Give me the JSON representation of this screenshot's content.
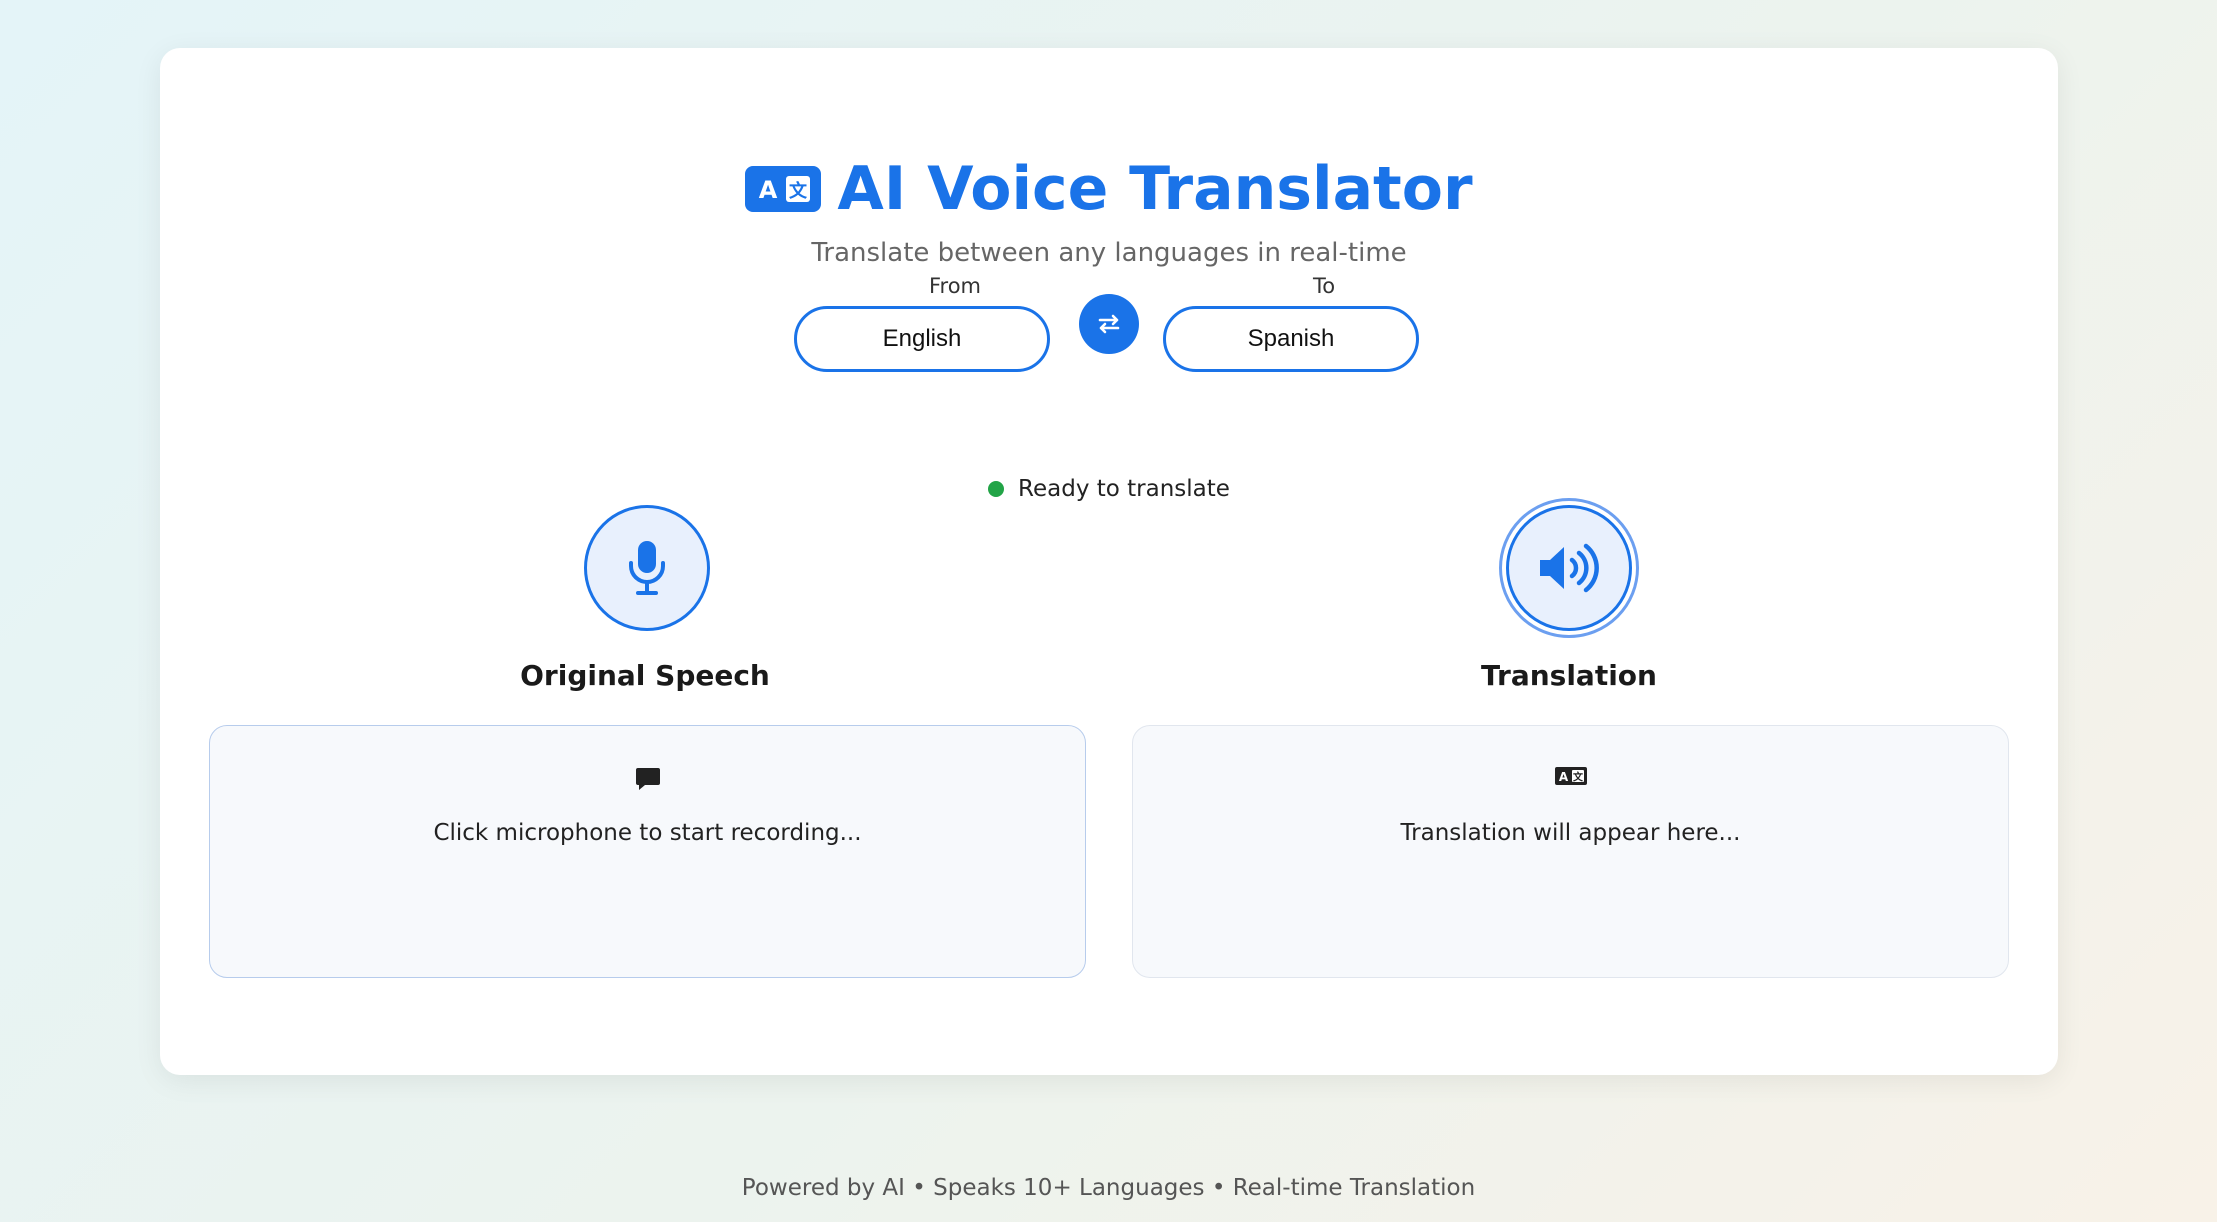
{
  "app": {
    "title": "AI Voice Translator",
    "subtitle": "Translate between any languages in real-time",
    "logo_icon": "translate-icon"
  },
  "languages": {
    "from_label": "From",
    "from_value": "English",
    "to_label": "To",
    "to_value": "Spanish",
    "swap_icon": "swap-arrows-icon"
  },
  "status": {
    "text": "Ready to translate",
    "color": "#22a447"
  },
  "panels": {
    "original": {
      "title": "Original Speech",
      "placeholder": "Click microphone to start recording...",
      "button_icon": "microphone-icon",
      "placeholder_icon": "speech-bubble-icon"
    },
    "translation": {
      "title": "Translation",
      "placeholder": "Translation will appear here...",
      "button_icon": "speaker-icon",
      "placeholder_icon": "translate-icon"
    }
  },
  "footer": {
    "text": "Powered by AI • Speaks 10+ Languages • Real-time Translation"
  },
  "colors": {
    "accent": "#1a73e8",
    "panel_bg": "#f7f9fc",
    "status_ready": "#22a447"
  }
}
